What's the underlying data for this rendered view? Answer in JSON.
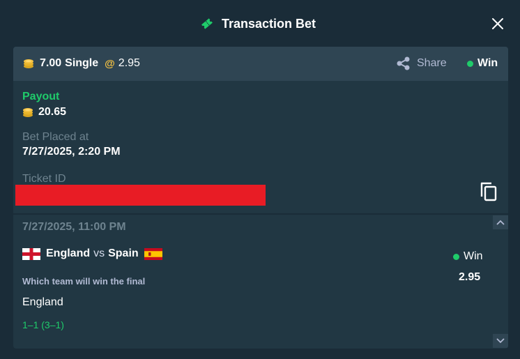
{
  "header": {
    "title": "Transaction Bet",
    "icon": "ticket-icon",
    "close_icon": "close-icon"
  },
  "bet": {
    "stake_amount": "7.00",
    "bet_type": "Single",
    "at_symbol": "@",
    "odds": "2.95",
    "share_label": "Share",
    "status": "Win",
    "payout_label": "Payout",
    "payout_value": "20.65",
    "placed_label": "Bet Placed at",
    "placed_value": "7/27/2025, 2:20 PM",
    "ticket_label": "Ticket ID"
  },
  "event": {
    "datetime": "7/27/2025, 11:00 PM",
    "team_home": "England",
    "vs": "vs",
    "team_away": "Spain",
    "status": "Win",
    "odds": "2.95",
    "market": "Which team will win the final",
    "selection": "England",
    "score": "1–1 (3–1)"
  },
  "colors": {
    "background": "#1a2c38",
    "card": "#213743",
    "card_header": "#2f4553",
    "win_green": "#1fcb6a",
    "muted": "#6e838f",
    "coin_gold": "#f5c242",
    "redaction": "#e81c25"
  }
}
